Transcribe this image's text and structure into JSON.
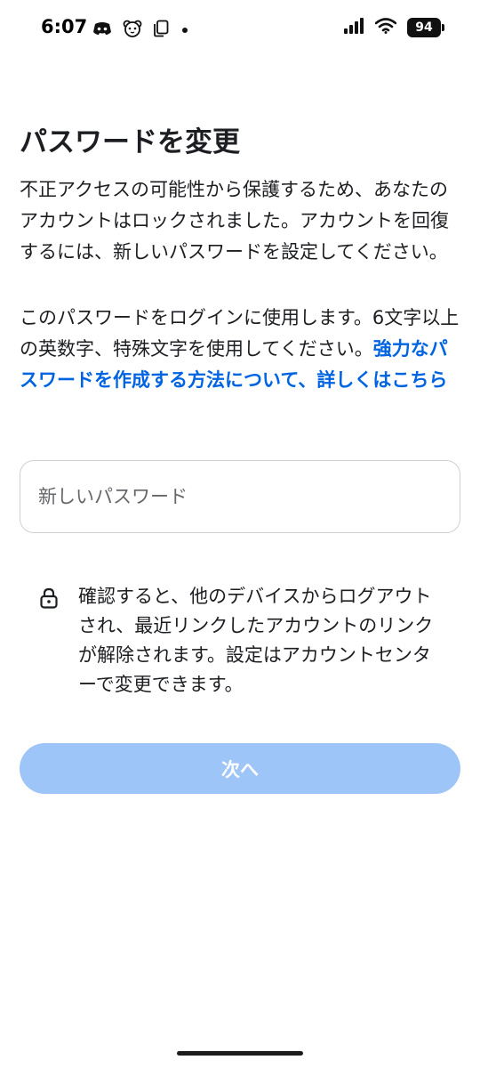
{
  "status_bar": {
    "time": "6:07",
    "battery_level": "94",
    "icons_left": [
      "discord-icon",
      "bear-face-icon",
      "copy-icon",
      "dot-icon"
    ],
    "icons_right": [
      "signal-icon",
      "wifi-icon",
      "battery-icon"
    ]
  },
  "page": {
    "title": "パスワードを変更",
    "description": "不正アクセスの可能性から保護するため、あなたのアカウントはロックされました。アカウントを回復するには、新しいパスワードを設定してください。",
    "requirements": "このパスワードをログインに使用します。6文字以上の英数字、特殊文字を使用してください。",
    "help_link": "強力なパスワードを作成する方法について、詳しくはこちら"
  },
  "password_input": {
    "placeholder": "新しいパスワード",
    "value": ""
  },
  "notice": {
    "icon": "lock-icon",
    "text": "確認すると、他のデバイスからログアウトされ、最近リンクしたアカウントのリンクが解除されます。設定はアカウントセンターで変更できます。"
  },
  "next_button": {
    "label": "次へ",
    "state": "disabled"
  },
  "colors": {
    "link": "#0064e0",
    "button_disabled": "#9ec5f7",
    "text": "#1c1e21",
    "placeholder": "#65676b"
  }
}
